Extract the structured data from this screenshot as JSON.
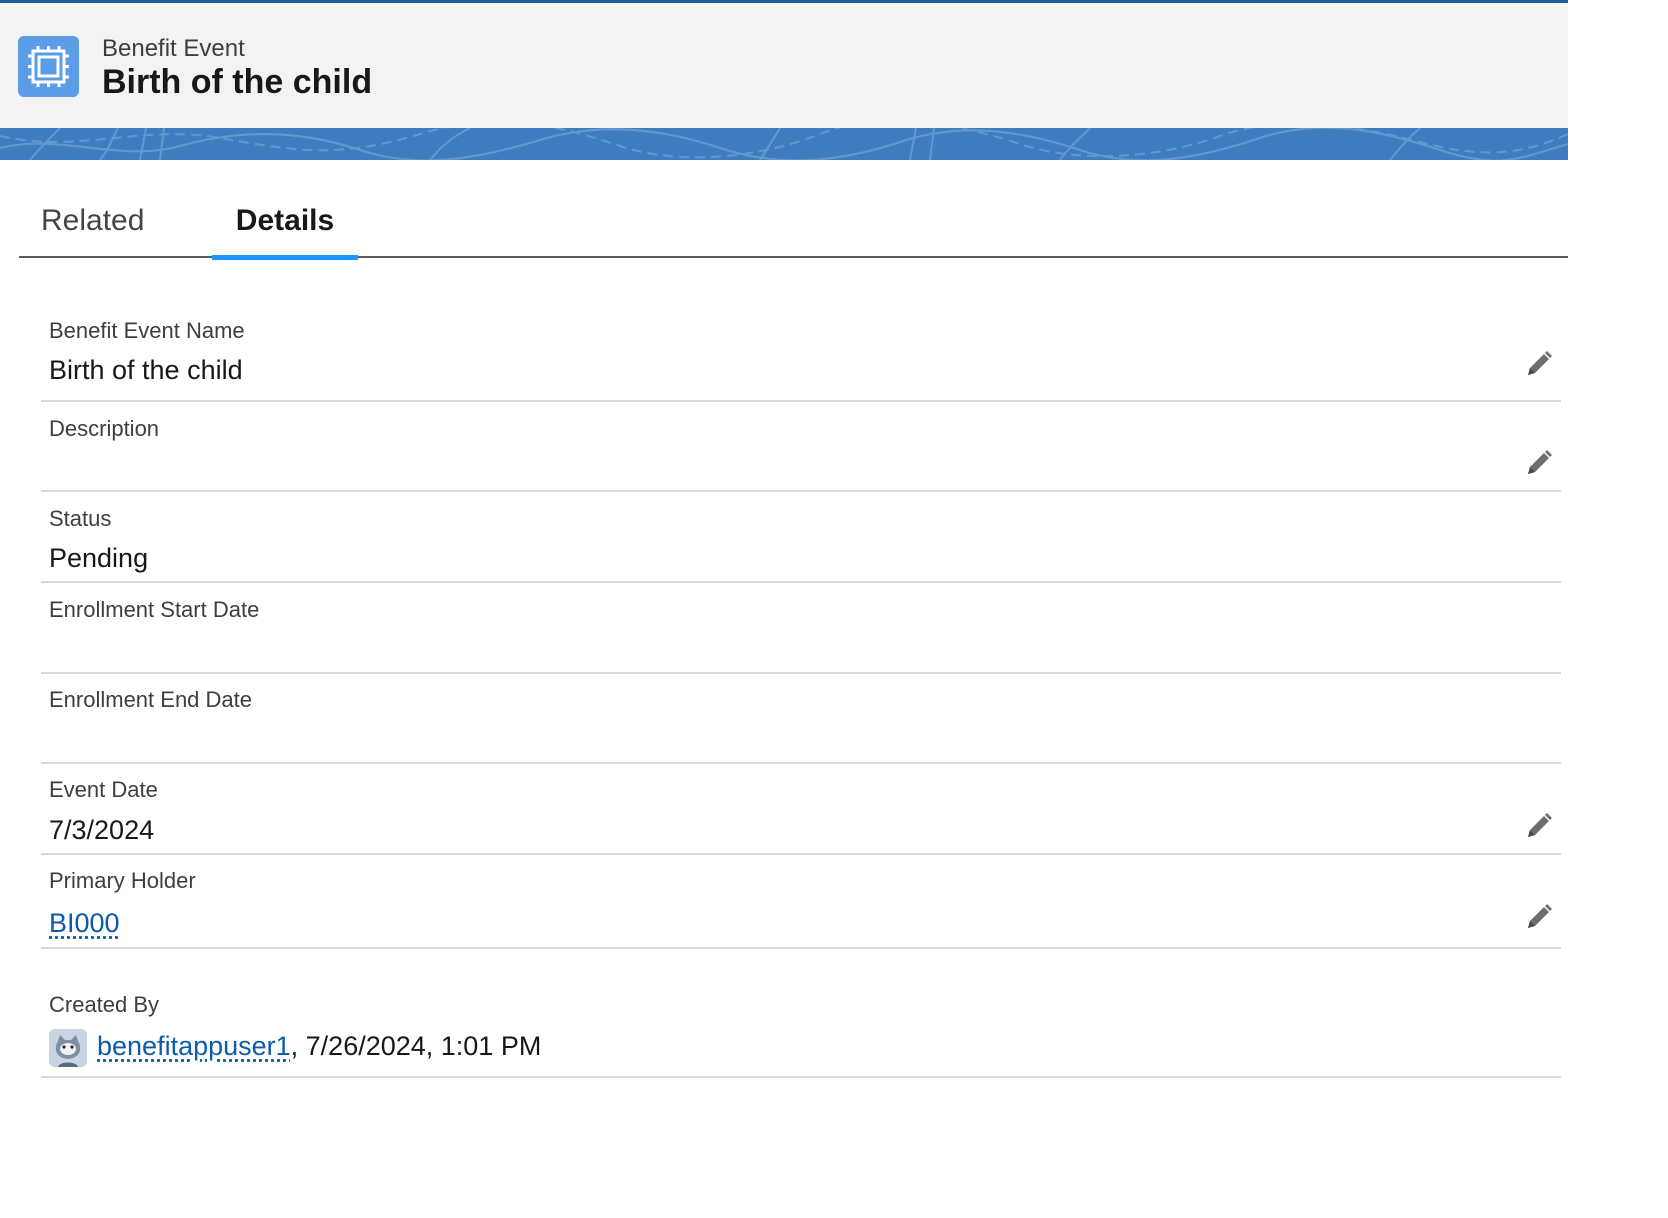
{
  "header": {
    "object_type": "Benefit Event",
    "record_title": "Birth of the child",
    "icon": "benefit-event-icon",
    "accent_color": "#5b9de6"
  },
  "tabs": [
    {
      "label": "Related",
      "selected": false
    },
    {
      "label": "Details",
      "selected": true
    }
  ],
  "fields": {
    "benefit_event_name": {
      "label": "Benefit Event Name",
      "value": "Birth of the child",
      "editable": true
    },
    "description": {
      "label": "Description",
      "value": "",
      "editable": true
    },
    "status": {
      "label": "Status",
      "value": "Pending",
      "editable": false
    },
    "enrollment_start_date": {
      "label": "Enrollment Start Date",
      "value": "",
      "editable": false
    },
    "enrollment_end_date": {
      "label": "Enrollment End Date",
      "value": "",
      "editable": false
    },
    "event_date": {
      "label": "Event Date",
      "value": "7/3/2024",
      "editable": true
    },
    "primary_holder": {
      "label": "Primary Holder",
      "value": "BI000",
      "editable": true
    },
    "created_by": {
      "label": "Created By",
      "user": "benefitappuser1",
      "timestamp": ", 7/26/2024, 1:01 PM"
    }
  },
  "colors": {
    "link": "#0b5cab",
    "tab_active": "#1b96ff",
    "banner": "#3f7dc0"
  }
}
